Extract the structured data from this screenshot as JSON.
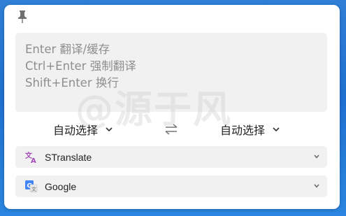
{
  "input": {
    "placeholder_lines": [
      "Enter 翻译/缓存",
      "Ctrl+Enter 强制翻译",
      "Shift+Enter 换行"
    ]
  },
  "watermark": "@源于风",
  "languages": {
    "source": "自动选择",
    "target": "自动选择"
  },
  "services": [
    {
      "label": "STranslate",
      "icon": "translate-icon",
      "color": "#a54bb8"
    },
    {
      "label": "Google",
      "icon": "google-translate-icon",
      "color": "#4285f4"
    }
  ]
}
